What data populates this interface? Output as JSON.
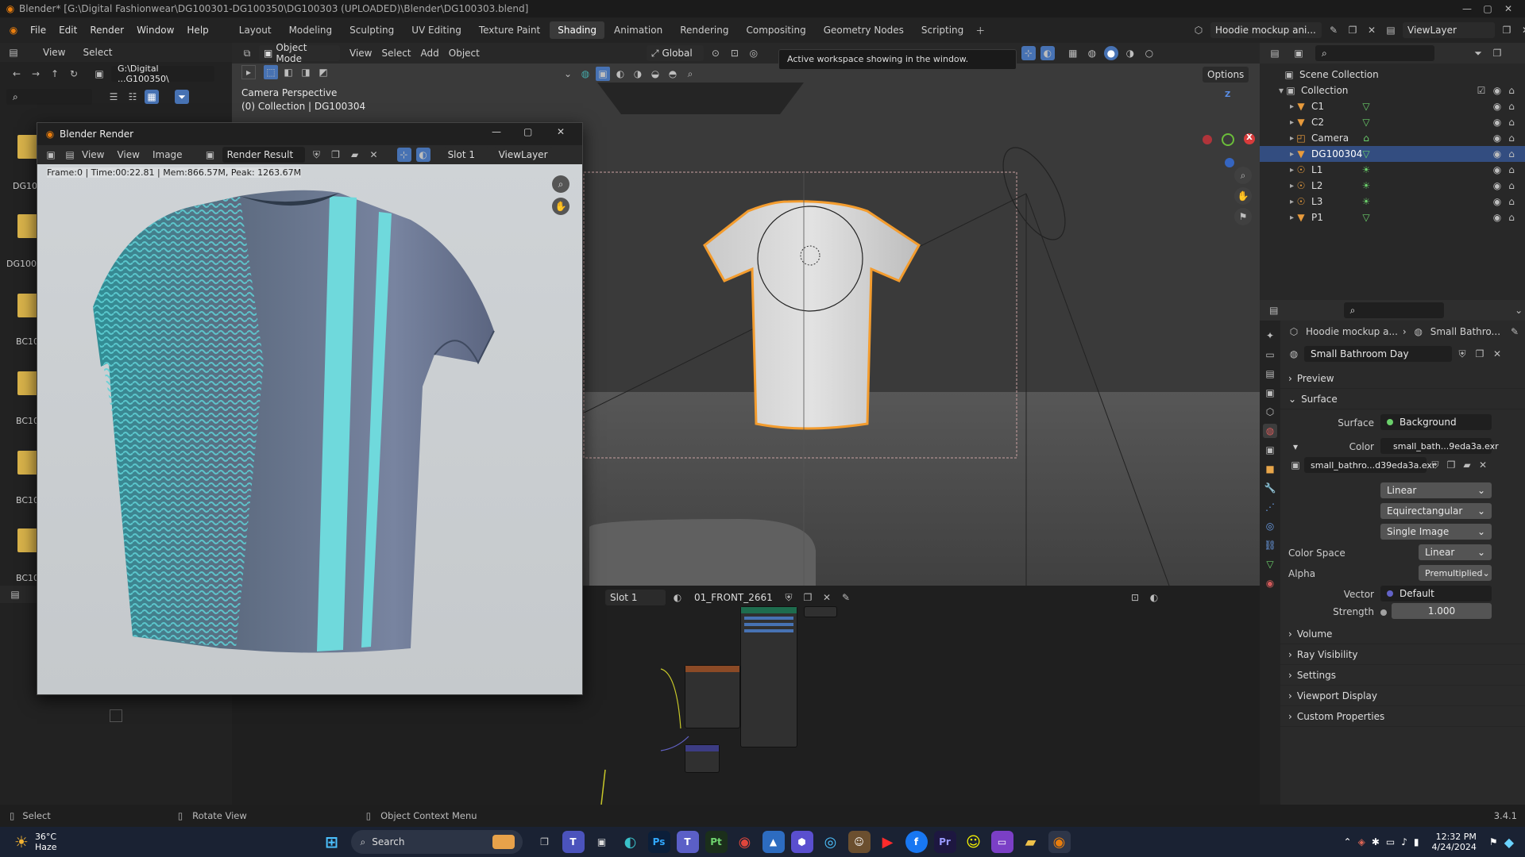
{
  "title_bar": {
    "title": "Blender* [G:\\Digital Fashionwear\\DG100301-DG100350\\DG100303 (UPLOADED)\\Blender\\DG100303.blend]"
  },
  "menu": {
    "items": [
      "File",
      "Edit",
      "Render",
      "Window",
      "Help"
    ],
    "workspaces": [
      "Layout",
      "Modeling",
      "Sculpting",
      "UV Editing",
      "Texture Paint",
      "Shading",
      "Animation",
      "Rendering",
      "Compositing",
      "Geometry Nodes",
      "Scripting"
    ],
    "active_workspace": "Shading",
    "scene_name": "Hoodie mockup ani...",
    "view_layer": "ViewLayer"
  },
  "tooltip": "Active workspace showing in the window.",
  "file_browser": {
    "menu": [
      "View",
      "Select"
    ],
    "path": "G:\\Digital ...G100350\\",
    "folders": [
      "DG10",
      "DG100",
      "BC10",
      "BC10",
      "BC10",
      "BC10"
    ]
  },
  "viewport": {
    "mode": "Object Mode",
    "menu": [
      "View",
      "Select",
      "Add",
      "Object"
    ],
    "transform_orientation": "Global",
    "options_label": "Options",
    "camera_label": "Camera Perspective",
    "collection_label": "(0) Collection | DG100304",
    "axis_labels": [
      "Z",
      "X"
    ]
  },
  "render_window": {
    "title": "Blender Render",
    "menu": [
      "View",
      "View",
      "Image"
    ],
    "image_name": "Render Result",
    "slot": "Slot 1",
    "view_layer": "ViewLayer",
    "stats": "Frame:0 | Time:00:22.81 | Mem:866.57M, Peak: 1263.67M"
  },
  "node_editor": {
    "slot": "Slot 1",
    "material": "01_FRONT_2661"
  },
  "outliner": {
    "root": "Scene Collection",
    "collection": "Collection",
    "items": [
      {
        "name": "C1",
        "icon": "mesh-icon"
      },
      {
        "name": "C2",
        "icon": "mesh-icon"
      },
      {
        "name": "Camera",
        "icon": "camera-icon"
      },
      {
        "name": "DG100304",
        "icon": "mesh-icon",
        "selected": true
      },
      {
        "name": "L1",
        "icon": "light-icon"
      },
      {
        "name": "L2",
        "icon": "light-icon"
      },
      {
        "name": "L3",
        "icon": "light-icon"
      },
      {
        "name": "P1",
        "icon": "mesh-icon"
      }
    ]
  },
  "properties": {
    "breadcrumb_scene": "Hoodie mockup a...",
    "breadcrumb_world": "Small Bathro...",
    "world_name": "Small Bathroom Day",
    "panels": {
      "preview": "Preview",
      "surface": "Surface",
      "volume": "Volume",
      "ray_visibility": "Ray Visibility",
      "settings": "Settings",
      "viewport_display": "Viewport Display",
      "custom_properties": "Custom Properties"
    },
    "surface_label": "Surface",
    "surface_value": "Background",
    "color_label": "Color",
    "color_value": "small_bath...9eda3a.exr",
    "image_name": "small_bathro...d39eda3a.exr",
    "interpolation": "Linear",
    "projection": "Equirectangular",
    "source": "Single Image",
    "color_space_label": "Color Space",
    "color_space": "Linear",
    "alpha_label": "Alpha",
    "alpha": "Premultiplied",
    "vector_label": "Vector",
    "vector": "Default",
    "strength_label": "Strength",
    "strength": "1.000"
  },
  "status_bar": {
    "select": "Select",
    "rotate": "Rotate View",
    "context": "Object Context Menu",
    "version": "3.4.1"
  },
  "taskbar": {
    "weather_temp": "36°C",
    "weather_desc": "Haze",
    "search": "Search",
    "time": "12:32 PM",
    "date": "4/24/2024",
    "apps": [
      {
        "label": "Ps",
        "color": "#0b1f3a",
        "fg": "#31a8ff"
      },
      {
        "label": "Pt",
        "color": "#1b2f1b",
        "fg": "#6ed36e"
      },
      {
        "label": "Pr",
        "color": "#1d1740",
        "fg": "#9999ff"
      }
    ]
  }
}
